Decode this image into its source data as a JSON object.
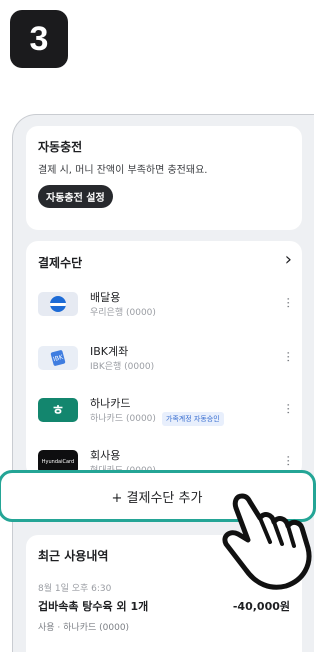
{
  "step": "3",
  "auto_charge": {
    "title": "자동충전",
    "description": "결제 시, 머니 잔액이 부족하면 충전돼요.",
    "button": "자동충전 설정"
  },
  "payment": {
    "title": "결제수단",
    "items": [
      {
        "name": "배달용",
        "sub": "우리은행 (0000)",
        "icon": "woori-bank-icon"
      },
      {
        "name": "IBK계좌",
        "sub": "IBK은행 (0000)",
        "icon": "ibk-bank-icon"
      },
      {
        "name": "하나카드",
        "sub": "하나카드 (0000)",
        "tag": "가족계정 자동승인",
        "icon": "hana-card-icon"
      },
      {
        "name": "회사용",
        "sub": "현대카드 (0000)",
        "icon": "hyundai-card-icon",
        "logo_text": "HyundaiCard"
      }
    ],
    "add_label": "+ 결제수단 추가"
  },
  "recent": {
    "title": "최근 사용내역",
    "date": "8월 1일 오후 6:30",
    "merchant": "겁바속촉 탕수육 외 1개",
    "amount": "-40,000원",
    "method": "사용 · 하나카드 (0000)"
  },
  "colors": {
    "accent": "#24a596",
    "hana": "#13866e"
  }
}
